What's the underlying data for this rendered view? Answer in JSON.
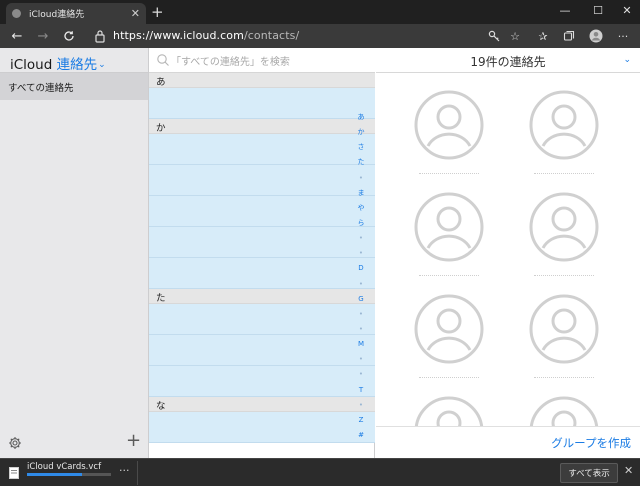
{
  "browser": {
    "tab_title": "iCloud連絡先",
    "tab_close": "✕",
    "new_tab": "+",
    "window_controls": {
      "minimize": "—",
      "maximize": "☐",
      "close": "✕"
    },
    "url_host": "https://www.icloud.com",
    "url_path": "/contacts/",
    "more_label": "···"
  },
  "sidebar": {
    "app_name": "iCloud",
    "app_section": "連絡先",
    "caret": "⌄",
    "group_all": "すべての連絡先",
    "add_label": "+"
  },
  "list": {
    "search_placeholder": "「すべての連絡先」を検索",
    "sections": [
      {
        "header": "あ",
        "rows": 1
      },
      {
        "header": "か",
        "rows": 5
      },
      {
        "header": "た",
        "rows": 3
      },
      {
        "header": "な",
        "rows": 1
      }
    ],
    "index": [
      "あ",
      "か",
      "さ",
      "た",
      "•",
      "ま",
      "や",
      "ら",
      "•",
      "•",
      "D",
      "•",
      "G",
      "•",
      "•",
      "M",
      "•",
      "•",
      "T",
      "•",
      "Z",
      "#"
    ]
  },
  "cards": {
    "title": "19件の連絡先",
    "caret": "⌄",
    "make_group": "グループを作成"
  },
  "download": {
    "file_name": "iCloud vCards.vcf",
    "more": "···",
    "show_all": "すべて表示",
    "close": "✕",
    "progress": 0.65
  },
  "colors": {
    "accent": "#1b7ce4",
    "row_selected": "#d7ecf9"
  }
}
